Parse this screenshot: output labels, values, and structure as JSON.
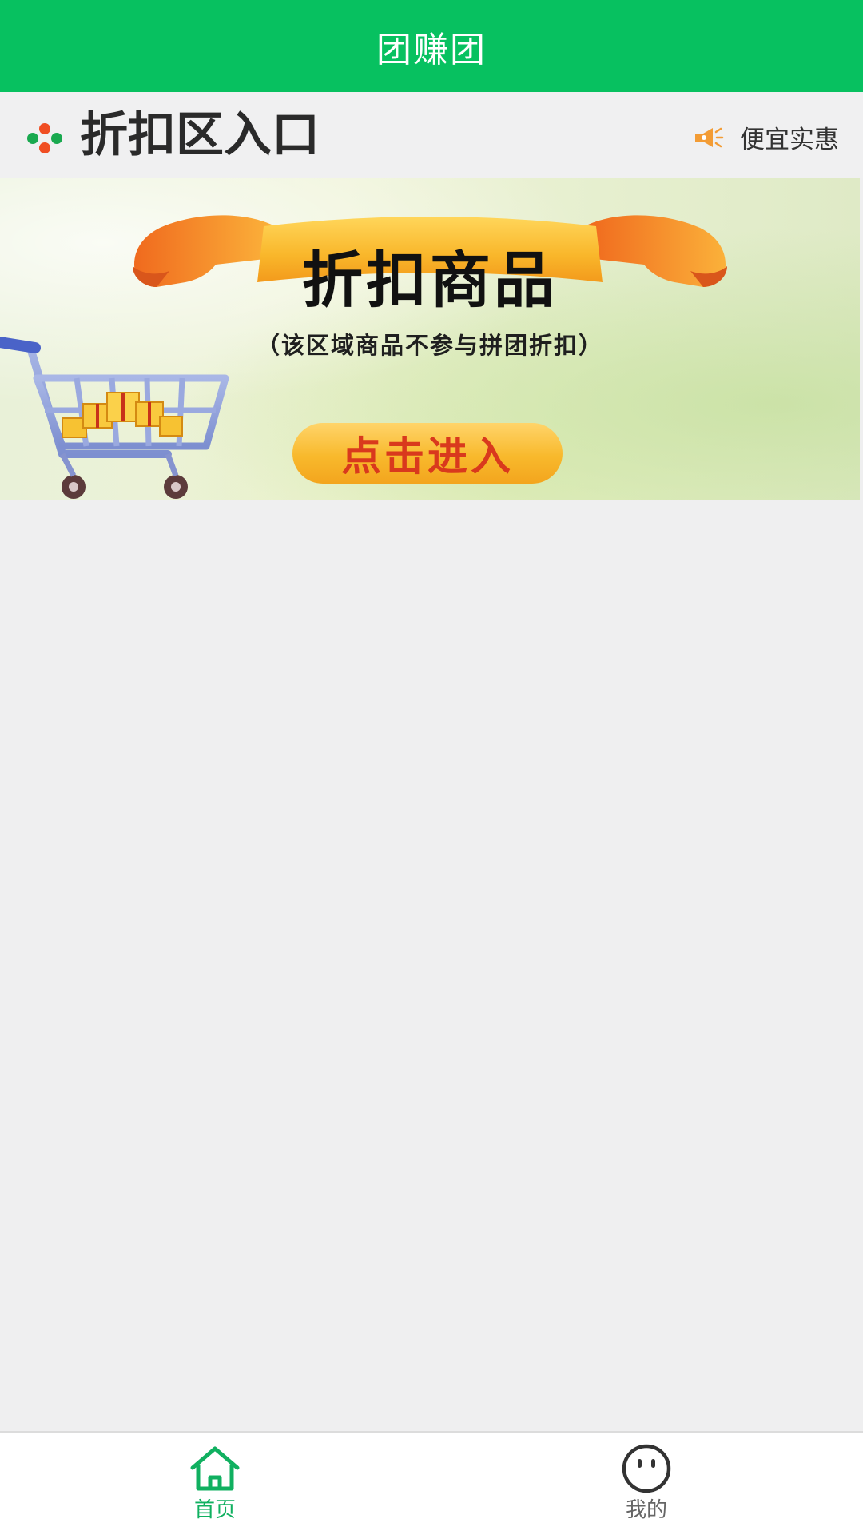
{
  "app": {
    "title": "团赚团"
  },
  "section": {
    "icon": "four-dot-icon",
    "title": "折扣区入口",
    "side_icon": "megaphone-icon",
    "side_text": "便宜实惠"
  },
  "banner": {
    "title": "折扣商品",
    "subtitle": "（该区域商品不参与拼团折扣）",
    "button_label": "点击进入",
    "art": "shopping-cart-with-gifts"
  },
  "bottom_nav": {
    "items": [
      {
        "label": "首页",
        "icon": "home-icon",
        "active": true
      },
      {
        "label": "我的",
        "icon": "face-icon",
        "active": false
      }
    ]
  },
  "colors": {
    "brand_green": "#07c160",
    "active_tab": "#10b060",
    "orange": "#f39c35",
    "background": "#efeff0"
  }
}
